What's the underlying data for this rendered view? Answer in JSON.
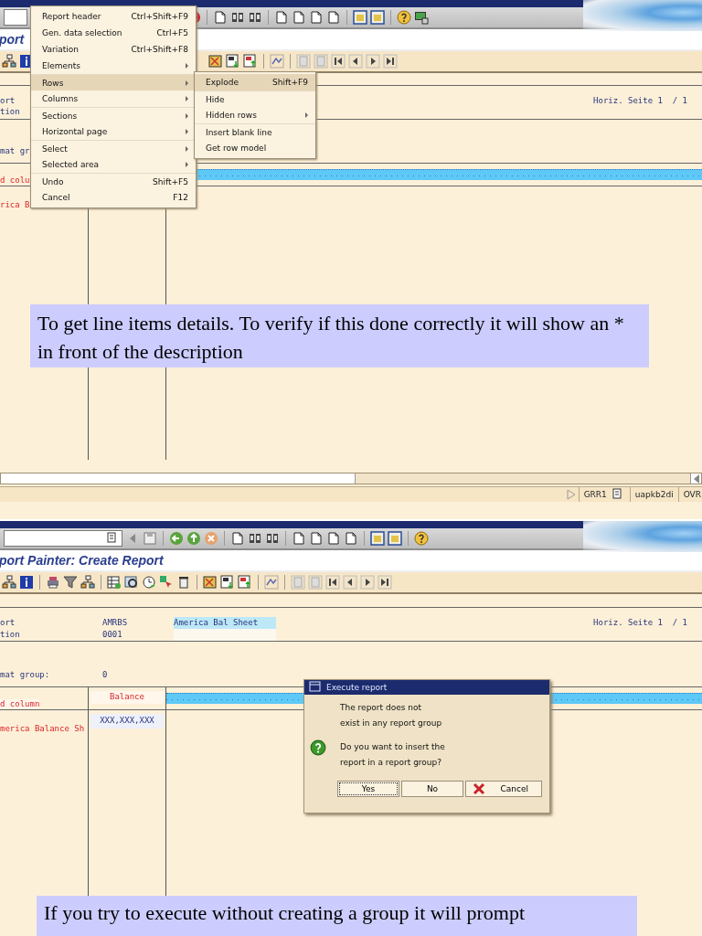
{
  "screen_1": {
    "title": "port",
    "header": {
      "labels": [
        "ort",
        "tion"
      ],
      "page": "Horiz. Seite 1  / 1"
    },
    "format_label": "mat gr",
    "column_header": "d colu",
    "row_label": "rica B",
    "edit_menu": {
      "items": [
        {
          "label": "Report header",
          "shortcut": "Ctrl+Shift+F9",
          "submenu": false,
          "selected": false,
          "divider_above": false
        },
        {
          "label": "Gen. data selection",
          "shortcut": "Ctrl+F5",
          "submenu": false,
          "selected": false,
          "divider_above": false
        },
        {
          "label": "Variation",
          "shortcut": "Ctrl+Shift+F8",
          "submenu": false,
          "selected": false,
          "divider_above": false
        },
        {
          "label": "Elements",
          "submenu": true,
          "selected": false,
          "divider_above": false
        },
        {
          "label": "Rows",
          "submenu": true,
          "selected": true,
          "divider_above": true
        },
        {
          "label": "Columns",
          "submenu": true,
          "selected": false,
          "divider_above": false
        },
        {
          "label": "Sections",
          "submenu": true,
          "selected": false,
          "divider_above": true
        },
        {
          "label": "Horizontal page",
          "submenu": true,
          "selected": false,
          "divider_above": false
        },
        {
          "label": "Select",
          "submenu": true,
          "selected": false,
          "divider_above": true
        },
        {
          "label": "Selected area",
          "submenu": true,
          "selected": false,
          "divider_above": false
        },
        {
          "label": "Undo",
          "shortcut": "Shift+F5",
          "submenu": false,
          "selected": false,
          "divider_above": true
        },
        {
          "label": "Cancel",
          "shortcut": "F12",
          "submenu": false,
          "selected": false,
          "divider_above": false
        }
      ]
    },
    "rows_submenu": {
      "items": [
        {
          "label": "Explode",
          "shortcut": "Shift+F9",
          "submenu": false,
          "selected": true,
          "divider_above": false
        },
        {
          "label": "Hide",
          "submenu": false,
          "selected": false,
          "divider_above": true
        },
        {
          "label": "Hidden rows",
          "submenu": true,
          "selected": false,
          "divider_above": false
        },
        {
          "label": "Insert blank line",
          "submenu": false,
          "selected": false,
          "divider_above": true
        },
        {
          "label": "Get row model",
          "submenu": false,
          "selected": false,
          "divider_above": false
        }
      ]
    },
    "caption": "To get line items details. To verify if this done correctly it will show an * in front of the description",
    "status_bar": {
      "system": "GRR1",
      "server": "uapkb2di",
      "mode": "OVR"
    }
  },
  "screen_2": {
    "title": "port Painter: Create Report",
    "header": {
      "rows": [
        {
          "label": "ort",
          "value": "AMRBS",
          "description": "America Bal Sheet"
        },
        {
          "label": "tion",
          "value": "0001"
        }
      ],
      "page": "Horiz. Seite 1  / 1"
    },
    "format": {
      "label": "mat group:",
      "value": "0"
    },
    "column_headers": [
      "d column",
      "Balance"
    ],
    "row": {
      "label": "merica Balance Sh",
      "value": "XXX,XXX,XXX"
    },
    "dialog": {
      "title": "Execute report",
      "message": [
        "The report does not",
        "exist in any report group"
      ],
      "question": [
        "Do you want to insert the",
        "report in a report group?"
      ],
      "buttons": [
        {
          "label": "Yes",
          "kind": "plain",
          "focused": true
        },
        {
          "label": "No",
          "kind": "plain",
          "focused": false
        },
        {
          "label": "Cancel",
          "kind": "cancel",
          "focused": false
        }
      ]
    },
    "caption": "If you try to execute without creating a group it will prompt"
  }
}
